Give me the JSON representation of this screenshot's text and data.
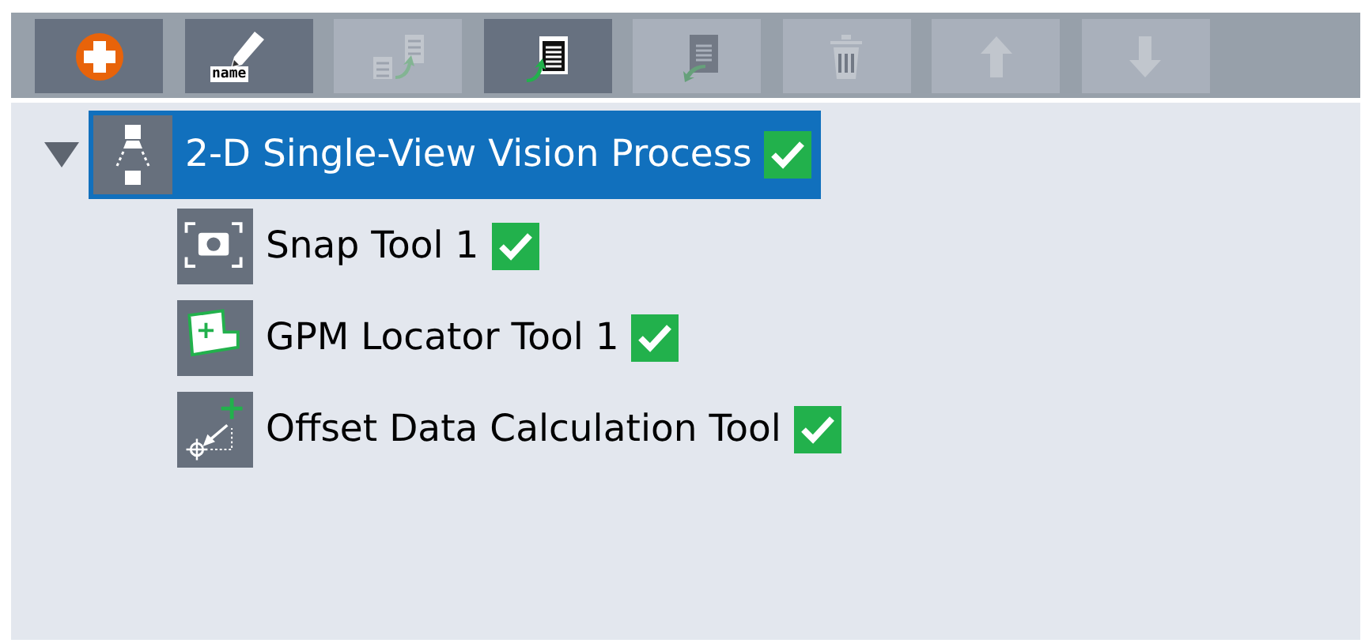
{
  "toolbar": [
    {
      "kind": "add",
      "disabled": false
    },
    {
      "kind": "rename",
      "label": "name",
      "disabled": false
    },
    {
      "kind": "copy",
      "disabled": true
    },
    {
      "kind": "paste",
      "disabled": false
    },
    {
      "kind": "paste-back",
      "disabled": true
    },
    {
      "kind": "delete",
      "disabled": true
    },
    {
      "kind": "up",
      "disabled": true
    },
    {
      "kind": "down",
      "disabled": true
    }
  ],
  "tree": [
    {
      "label": "2-D Single-View Vision Process",
      "kind": "process",
      "expanded": true,
      "selected": true,
      "checked": true,
      "children": [
        {
          "label": "Snap Tool 1",
          "kind": "snap",
          "selected": false,
          "checked": true
        },
        {
          "label": "GPM Locator Tool 1",
          "kind": "locator",
          "selected": false,
          "checked": true
        },
        {
          "label": "Offset Data Calculation Tool",
          "kind": "offset",
          "selected": false,
          "checked": true
        }
      ]
    }
  ]
}
